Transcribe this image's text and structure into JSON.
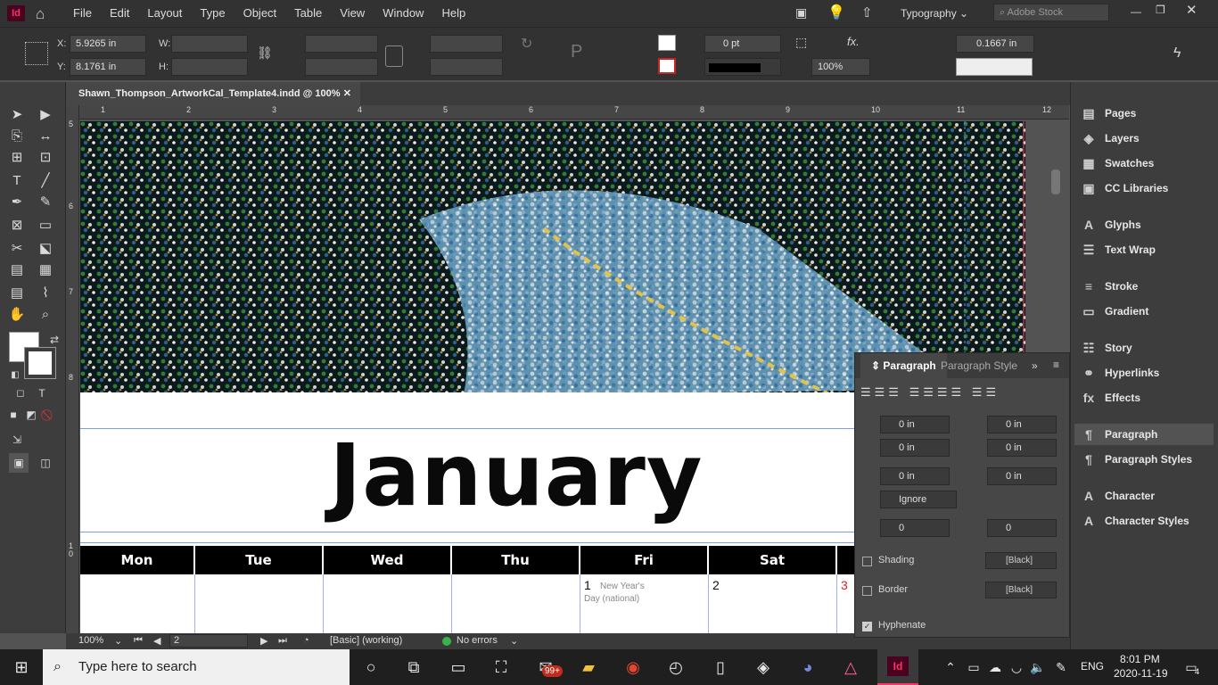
{
  "menubar": {
    "items": [
      "File",
      "Edit",
      "Layout",
      "Type",
      "Object",
      "Table",
      "View",
      "Window",
      "Help"
    ],
    "workspace": "Typography",
    "search_placeholder": "Adobe Stock"
  },
  "control": {
    "x_label": "X:",
    "x_value": "5.9265 in",
    "y_label": "Y:",
    "y_value": "8.1761 in",
    "w_label": "W:",
    "h_label": "H:",
    "stroke_weight": "0 pt",
    "zoom_pct": "100%",
    "offset": "0.1667 in"
  },
  "document": {
    "tab_title": "Shawn_Thompson_ArtworkCal_Template4.indd @ 100%",
    "ruler_h": [
      "1",
      "2",
      "3",
      "4",
      "5",
      "6",
      "7",
      "8",
      "9",
      "10",
      "11",
      "12"
    ],
    "ruler_v": [
      "5",
      "6",
      "7",
      "8",
      "1\n0"
    ],
    "month": "January",
    "days": [
      "Mon",
      "Tue",
      "Wed",
      "Thu",
      "Fri",
      "Sat"
    ],
    "cells": [
      {
        "num": "1",
        "note": "New Year's Day  (national)"
      },
      {
        "num": "2",
        "note": ""
      },
      {
        "num": "3",
        "note": ""
      }
    ]
  },
  "status": {
    "zoom": "100%",
    "page": "2",
    "style": "[Basic] (working)",
    "errors": "No errors"
  },
  "panels": {
    "items": [
      {
        "label": "Pages",
        "icon": "pages-icon"
      },
      {
        "label": "Layers",
        "icon": "layers-icon"
      },
      {
        "label": "Swatches",
        "icon": "swatches-icon"
      },
      {
        "label": "CC Libraries",
        "icon": "cc-libraries-icon"
      },
      {
        "label": "Glyphs",
        "icon": "glyphs-icon"
      },
      {
        "label": "Text Wrap",
        "icon": "text-wrap-icon"
      },
      {
        "label": "Stroke",
        "icon": "stroke-icon"
      },
      {
        "label": "Gradient",
        "icon": "gradient-icon"
      },
      {
        "label": "Story",
        "icon": "story-icon"
      },
      {
        "label": "Hyperlinks",
        "icon": "hyperlinks-icon"
      },
      {
        "label": "Effects",
        "icon": "effects-icon"
      },
      {
        "label": "Paragraph",
        "icon": "paragraph-icon"
      },
      {
        "label": "Paragraph Styles",
        "icon": "paragraph-styles-icon"
      },
      {
        "label": "Character",
        "icon": "character-icon"
      },
      {
        "label": "Character Styles",
        "icon": "character-styles-icon"
      }
    ]
  },
  "paragraph_panel": {
    "tab1": "Paragraph",
    "tab2": "Paragraph Style",
    "left_indent": "0 in",
    "right_indent": "0 in",
    "first_indent": "0 in",
    "last_indent": "0 in",
    "space_before": "0 in",
    "space_after": "0 in",
    "align_grid": "Ignore",
    "drop_lines": "0",
    "drop_chars": "0",
    "shading_label": "Shading",
    "shading_color": "[Black]",
    "border_label": "Border",
    "border_color": "[Black]",
    "hyphenate_label": "Hyphenate"
  },
  "taskbar": {
    "search_placeholder": "Type here to search",
    "badge": "99+",
    "lang": "ENG",
    "time": "8:01 PM",
    "date": "2020-11-19",
    "notif": "4"
  }
}
